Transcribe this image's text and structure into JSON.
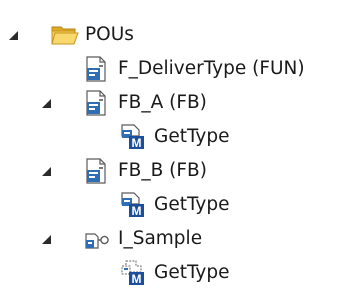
{
  "tree": {
    "root": {
      "label": "POUs",
      "icon": "folder-open-icon",
      "expanded": true
    },
    "items": [
      {
        "label": "F_DeliverType (FUN)",
        "icon": "function-pou-icon"
      },
      {
        "label": "FB_A (FB)",
        "icon": "function-block-icon",
        "expanded": true,
        "children": [
          {
            "label": "GetType",
            "icon": "method-icon"
          }
        ]
      },
      {
        "label": "FB_B (FB)",
        "icon": "function-block-icon",
        "expanded": true,
        "children": [
          {
            "label": "GetType",
            "icon": "method-icon"
          }
        ]
      },
      {
        "label": "I_Sample",
        "icon": "interface-icon",
        "expanded": true,
        "children": [
          {
            "label": "GetType",
            "icon": "interface-method-icon"
          }
        ]
      }
    ]
  },
  "colors": {
    "folder": "#f2c94c",
    "folder_dark": "#c99a1c",
    "doc_blue": "#2f6db5",
    "method_m": "#1b4f9c"
  }
}
